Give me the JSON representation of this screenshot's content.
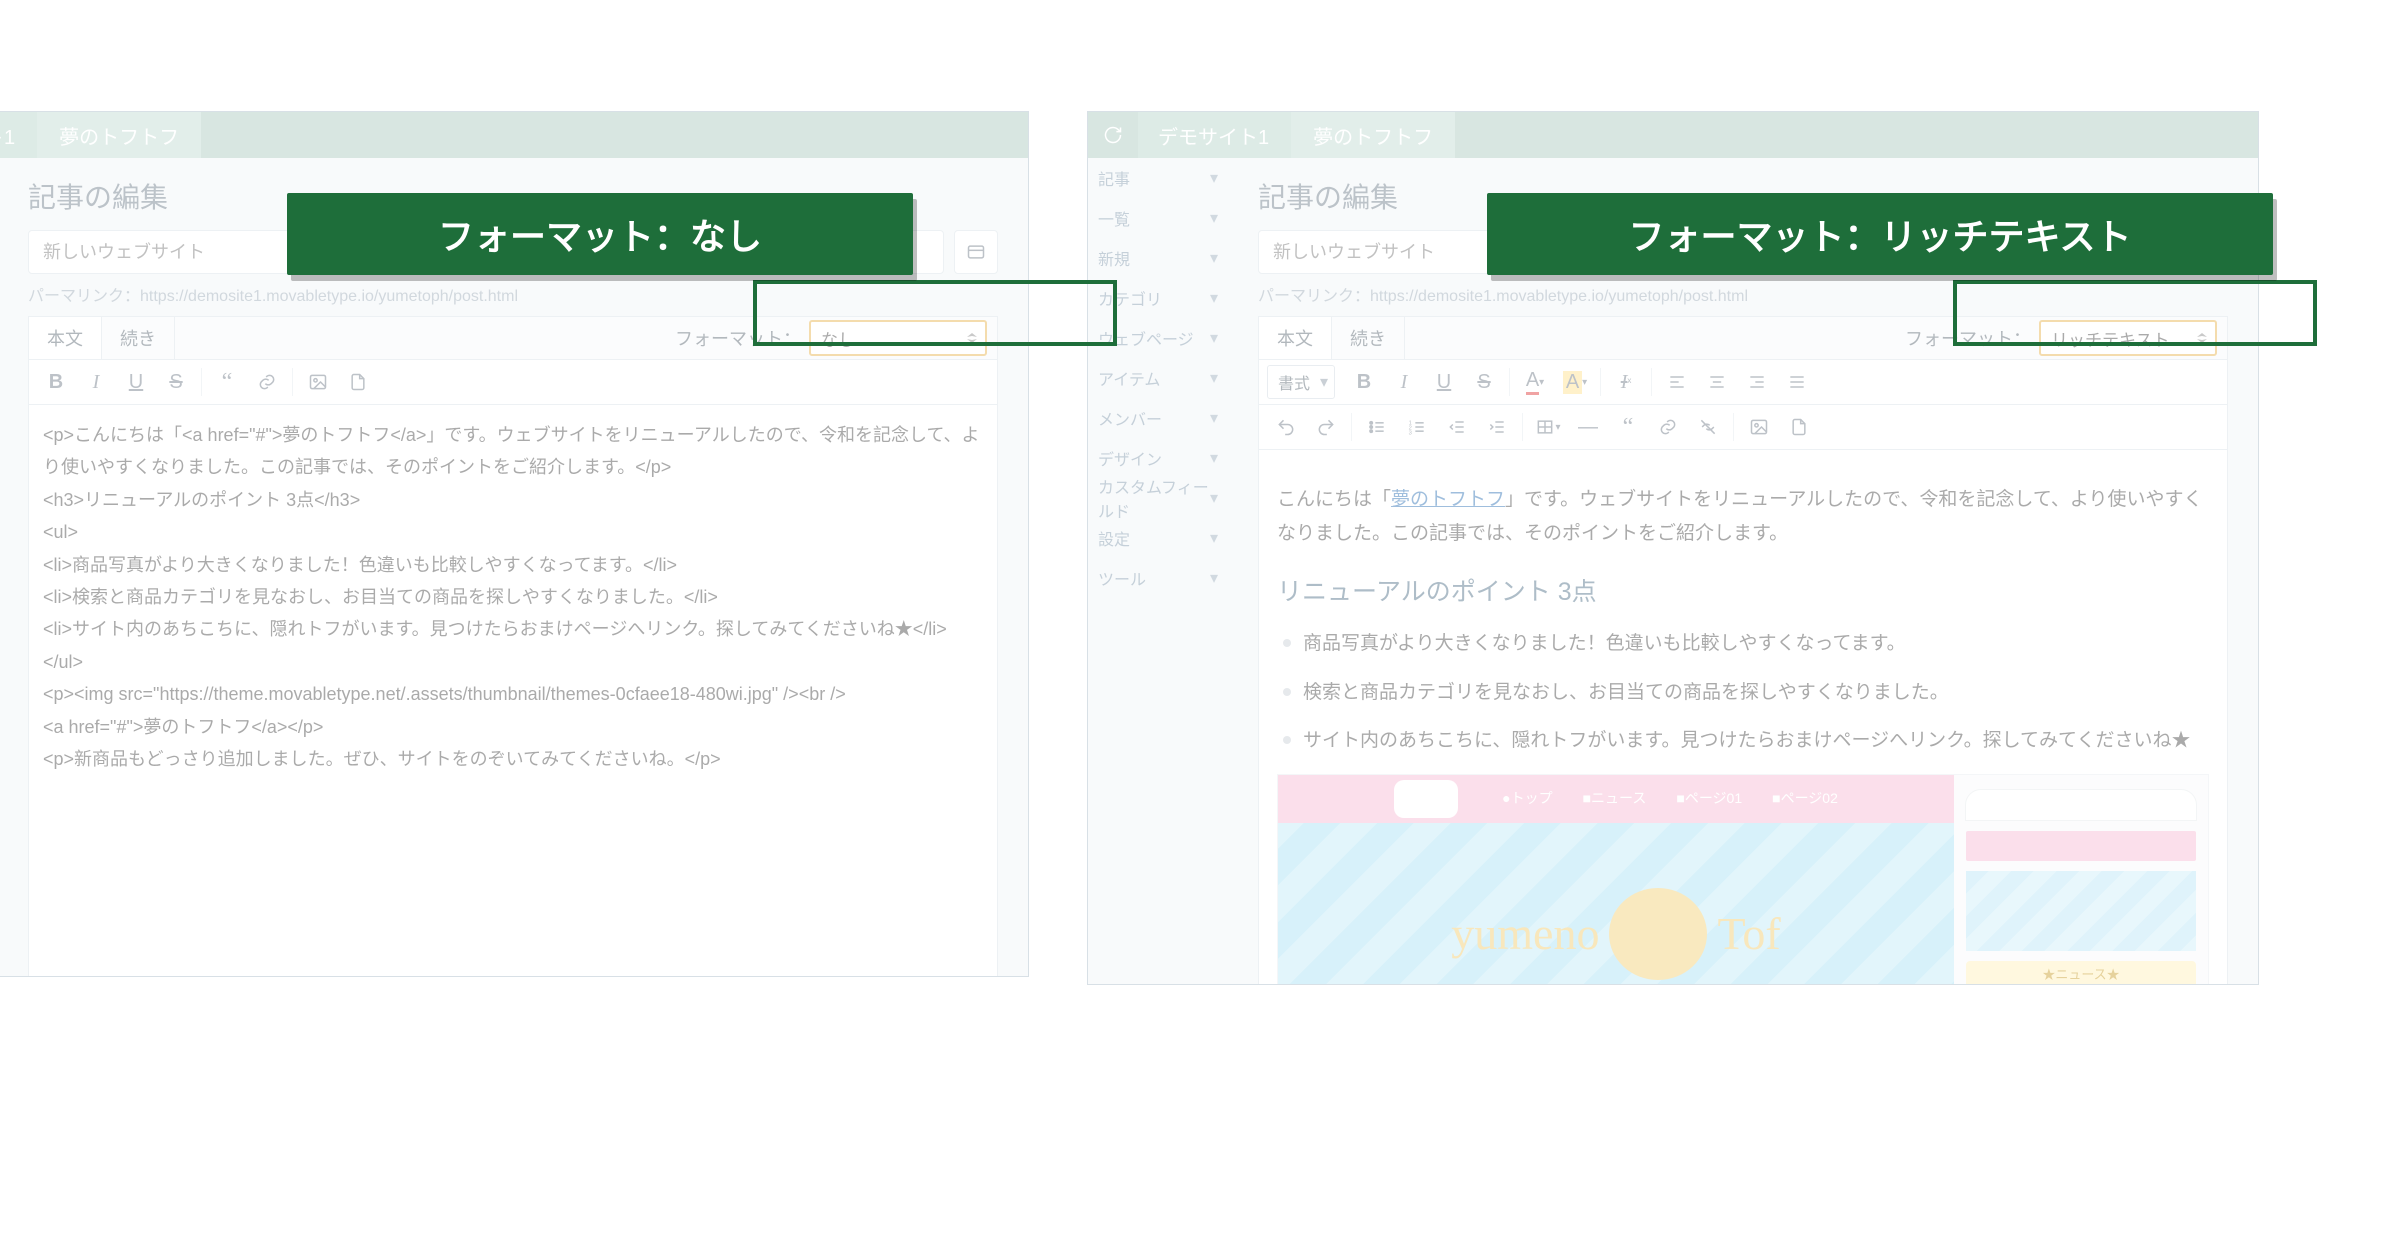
{
  "breadcrumb": {
    "site": "デモサイト1",
    "entry": "夢のトフトフ"
  },
  "page_heading": "記事の編集",
  "title_placeholder": "新しいウェブサイト",
  "permalink": {
    "label": "パーマリンク：",
    "url": "https://demosite1.movabletype.io/yumetoph/post.html"
  },
  "tabs": {
    "body": "本文",
    "more": "続き"
  },
  "format": {
    "label": "フォーマット：",
    "value_none": "なし",
    "value_rich": "リッチテキスト"
  },
  "style_dd": "書式",
  "sidebar_items": [
    "記事",
    "一覧",
    "新規",
    "カテゴリ",
    "ウェブページ",
    "アイテム",
    "メンバー",
    "デザイン",
    "カスタムフィールド",
    "設定",
    "ツール"
  ],
  "sidebar_partial": [
    "ページ",
    "フィールド"
  ],
  "toolbar": {
    "bold": "太字",
    "italic": "斜体",
    "underline": "下線",
    "strike": "取り消し線",
    "quote": "引用",
    "link": "リンク",
    "image": "画像",
    "file": "ファイル",
    "color": "文字色",
    "bgcolor": "背景色",
    "clear": "書式クリア",
    "alignl": "左揃え",
    "alignc": "中央",
    "alignr": "右揃え",
    "alignj": "両端",
    "undo": "元に戻す",
    "redo": "やり直し",
    "ul": "箇条書き",
    "ol": "番号リスト",
    "indent": "インデント",
    "outdent": "アウトデント",
    "table": "表",
    "hr": "水平線",
    "bq": "ブロック引用",
    "asset": "アセット"
  },
  "callout_left": "フォーマット：なし",
  "callout_right": "フォーマット：リッチテキスト",
  "plain_lines": [
    "<p>こんにちは「<a href=\"#\">夢のトフトフ</a>」です。ウェブサイトをリニューアルしたので、令和を記念して、より使いやすくなりました。この記事では、そのポイントをご紹介します。</p>",
    "<h3>リニューアルのポイント 3点</h3>",
    "<ul>",
    "<li>商品写真がより大きくなりました！色違いも比較しやすくなってます。</li>",
    "<li>検索と商品カテゴリを見なおし、お目当ての商品を探しやすくなりました。</li>",
    "<li>サイト内のあちこちに、隠れトフがいます。見つけたらおまけページへリンク。探してみてくださいね★</li>",
    "</ul>",
    "<p><img src=\"https://theme.movabletype.net/.assets/thumbnail/themes-0cfaee18-480wi.jpg\" /><br />",
    "<a href=\"#\">夢のトフトフ</a></p>",
    "<p>新商品もどっさり追加しました。ぜひ、サイトをのぞいてみてくださいね。</p>"
  ],
  "rich": {
    "intro_a": "こんにちは「",
    "link": "夢のトフトフ",
    "intro_b": "」です。ウェブサイトをリニューアルしたので、令和を記念して、より使いやすくなりました。この記事では、そのポイントをご紹介します。",
    "heading": "リニューアルのポイント 3点",
    "bullets": [
      "商品写真がより大きくなりました！色違いも比較しやすくなってます。",
      "検索と商品カテゴリを見なおし、お目当ての商品を探しやすくなりました。",
      "サイト内のあちこちに、隠れトフがいます。見つけたらおまけページへリンク。探してみてくださいね★"
    ]
  },
  "mock": {
    "nav": [
      "●トップ",
      "■ニュース",
      "■ページ01",
      "■ページ02"
    ],
    "logo_l": "yumeno",
    "logo_r": "Tof",
    "chip": "★ニュース★"
  }
}
